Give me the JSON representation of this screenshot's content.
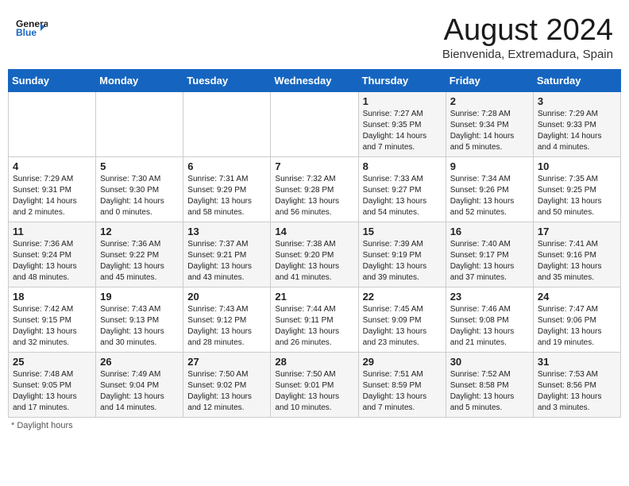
{
  "header": {
    "logo_general": "General",
    "logo_blue": "Blue",
    "main_title": "August 2024",
    "subtitle": "Bienvenida, Extremadura, Spain"
  },
  "days_of_week": [
    "Sunday",
    "Monday",
    "Tuesday",
    "Wednesday",
    "Thursday",
    "Friday",
    "Saturday"
  ],
  "weeks": [
    [
      {
        "day": "",
        "info": ""
      },
      {
        "day": "",
        "info": ""
      },
      {
        "day": "",
        "info": ""
      },
      {
        "day": "",
        "info": ""
      },
      {
        "day": "1",
        "info": "Sunrise: 7:27 AM\nSunset: 9:35 PM\nDaylight: 14 hours and 7 minutes."
      },
      {
        "day": "2",
        "info": "Sunrise: 7:28 AM\nSunset: 9:34 PM\nDaylight: 14 hours and 5 minutes."
      },
      {
        "day": "3",
        "info": "Sunrise: 7:29 AM\nSunset: 9:33 PM\nDaylight: 14 hours and 4 minutes."
      }
    ],
    [
      {
        "day": "4",
        "info": "Sunrise: 7:29 AM\nSunset: 9:31 PM\nDaylight: 14 hours and 2 minutes."
      },
      {
        "day": "5",
        "info": "Sunrise: 7:30 AM\nSunset: 9:30 PM\nDaylight: 14 hours and 0 minutes."
      },
      {
        "day": "6",
        "info": "Sunrise: 7:31 AM\nSunset: 9:29 PM\nDaylight: 13 hours and 58 minutes."
      },
      {
        "day": "7",
        "info": "Sunrise: 7:32 AM\nSunset: 9:28 PM\nDaylight: 13 hours and 56 minutes."
      },
      {
        "day": "8",
        "info": "Sunrise: 7:33 AM\nSunset: 9:27 PM\nDaylight: 13 hours and 54 minutes."
      },
      {
        "day": "9",
        "info": "Sunrise: 7:34 AM\nSunset: 9:26 PM\nDaylight: 13 hours and 52 minutes."
      },
      {
        "day": "10",
        "info": "Sunrise: 7:35 AM\nSunset: 9:25 PM\nDaylight: 13 hours and 50 minutes."
      }
    ],
    [
      {
        "day": "11",
        "info": "Sunrise: 7:36 AM\nSunset: 9:24 PM\nDaylight: 13 hours and 48 minutes."
      },
      {
        "day": "12",
        "info": "Sunrise: 7:36 AM\nSunset: 9:22 PM\nDaylight: 13 hours and 45 minutes."
      },
      {
        "day": "13",
        "info": "Sunrise: 7:37 AM\nSunset: 9:21 PM\nDaylight: 13 hours and 43 minutes."
      },
      {
        "day": "14",
        "info": "Sunrise: 7:38 AM\nSunset: 9:20 PM\nDaylight: 13 hours and 41 minutes."
      },
      {
        "day": "15",
        "info": "Sunrise: 7:39 AM\nSunset: 9:19 PM\nDaylight: 13 hours and 39 minutes."
      },
      {
        "day": "16",
        "info": "Sunrise: 7:40 AM\nSunset: 9:17 PM\nDaylight: 13 hours and 37 minutes."
      },
      {
        "day": "17",
        "info": "Sunrise: 7:41 AM\nSunset: 9:16 PM\nDaylight: 13 hours and 35 minutes."
      }
    ],
    [
      {
        "day": "18",
        "info": "Sunrise: 7:42 AM\nSunset: 9:15 PM\nDaylight: 13 hours and 32 minutes."
      },
      {
        "day": "19",
        "info": "Sunrise: 7:43 AM\nSunset: 9:13 PM\nDaylight: 13 hours and 30 minutes."
      },
      {
        "day": "20",
        "info": "Sunrise: 7:43 AM\nSunset: 9:12 PM\nDaylight: 13 hours and 28 minutes."
      },
      {
        "day": "21",
        "info": "Sunrise: 7:44 AM\nSunset: 9:11 PM\nDaylight: 13 hours and 26 minutes."
      },
      {
        "day": "22",
        "info": "Sunrise: 7:45 AM\nSunset: 9:09 PM\nDaylight: 13 hours and 23 minutes."
      },
      {
        "day": "23",
        "info": "Sunrise: 7:46 AM\nSunset: 9:08 PM\nDaylight: 13 hours and 21 minutes."
      },
      {
        "day": "24",
        "info": "Sunrise: 7:47 AM\nSunset: 9:06 PM\nDaylight: 13 hours and 19 minutes."
      }
    ],
    [
      {
        "day": "25",
        "info": "Sunrise: 7:48 AM\nSunset: 9:05 PM\nDaylight: 13 hours and 17 minutes."
      },
      {
        "day": "26",
        "info": "Sunrise: 7:49 AM\nSunset: 9:04 PM\nDaylight: 13 hours and 14 minutes."
      },
      {
        "day": "27",
        "info": "Sunrise: 7:50 AM\nSunset: 9:02 PM\nDaylight: 13 hours and 12 minutes."
      },
      {
        "day": "28",
        "info": "Sunrise: 7:50 AM\nSunset: 9:01 PM\nDaylight: 13 hours and 10 minutes."
      },
      {
        "day": "29",
        "info": "Sunrise: 7:51 AM\nSunset: 8:59 PM\nDaylight: 13 hours and 7 minutes."
      },
      {
        "day": "30",
        "info": "Sunrise: 7:52 AM\nSunset: 8:58 PM\nDaylight: 13 hours and 5 minutes."
      },
      {
        "day": "31",
        "info": "Sunrise: 7:53 AM\nSunset: 8:56 PM\nDaylight: 13 hours and 3 minutes."
      }
    ]
  ],
  "footer": {
    "note": "Daylight hours"
  }
}
